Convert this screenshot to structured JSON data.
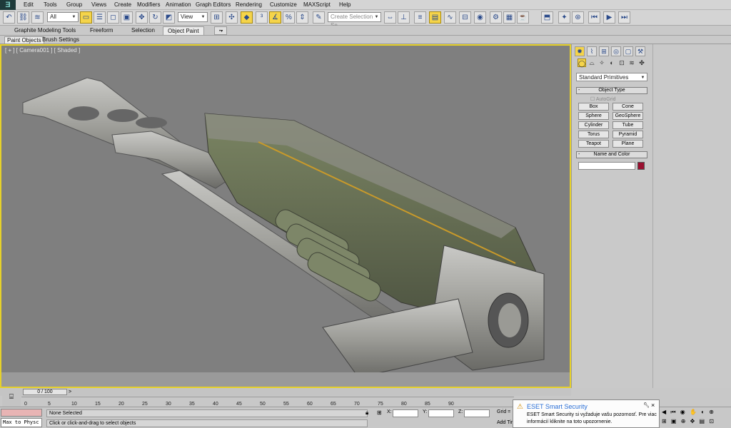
{
  "app": {
    "logo": "Ǝ"
  },
  "menubar": {
    "items": [
      "Edit",
      "Tools",
      "Group",
      "Views",
      "Create",
      "Modifiers",
      "Animation",
      "Graph Editors",
      "Rendering",
      "Customize",
      "MAXScript",
      "Help"
    ]
  },
  "toolbar": {
    "selection_filter": "All",
    "reference_coord": "View",
    "selection_set_placeholder": "Create Selection Se"
  },
  "ribbon": {
    "tabs": [
      "Graphite Modeling Tools",
      "Freeform",
      "Selection",
      "Object Paint"
    ],
    "active_tab": "Object Paint",
    "subtabs": [
      "Paint Objects",
      "Brush Settings"
    ]
  },
  "viewport": {
    "label": "[ + ] [ Camera001 ] [ Shaded ]"
  },
  "command_panel": {
    "category": "Standard Primitives",
    "object_type_title": "Object Type",
    "autogrid": "AutoGrid",
    "buttons": [
      "Box",
      "Cone",
      "Sphere",
      "GeoSphere",
      "Cylinder",
      "Tube",
      "Torus",
      "Pyramid",
      "Teapot",
      "Plane"
    ],
    "name_color_title": "Name and Color",
    "object_color": "#9a1030"
  },
  "timeline": {
    "slider_label": "0 / 100",
    "ticks": [
      "0",
      "5",
      "10",
      "15",
      "20",
      "25",
      "30",
      "35",
      "40",
      "45",
      "50",
      "55",
      "60",
      "65",
      "70",
      "75",
      "80",
      "85",
      "90"
    ]
  },
  "status": {
    "maxscript": "Max to Physc",
    "selection": "None Selected",
    "prompt": "Click or click-and-drag to select objects",
    "x_label": "X:",
    "y_label": "Y:",
    "z_label": "Z:",
    "grid_label": "Grid =",
    "add_time_tag": "Add Tim"
  },
  "notification": {
    "title": "ESET Smart Security",
    "line1": "ESET Smart Security si vyžaduje vašu pozornosť. Pre viac",
    "line2": "informácií kliknite na toto upozornenie.",
    "accent": "#2a6fd6"
  },
  "colors": {
    "viewport_border": "#e6d12a",
    "viewport_bg": "#7f7f7f",
    "highlight": "#f5d44a"
  }
}
